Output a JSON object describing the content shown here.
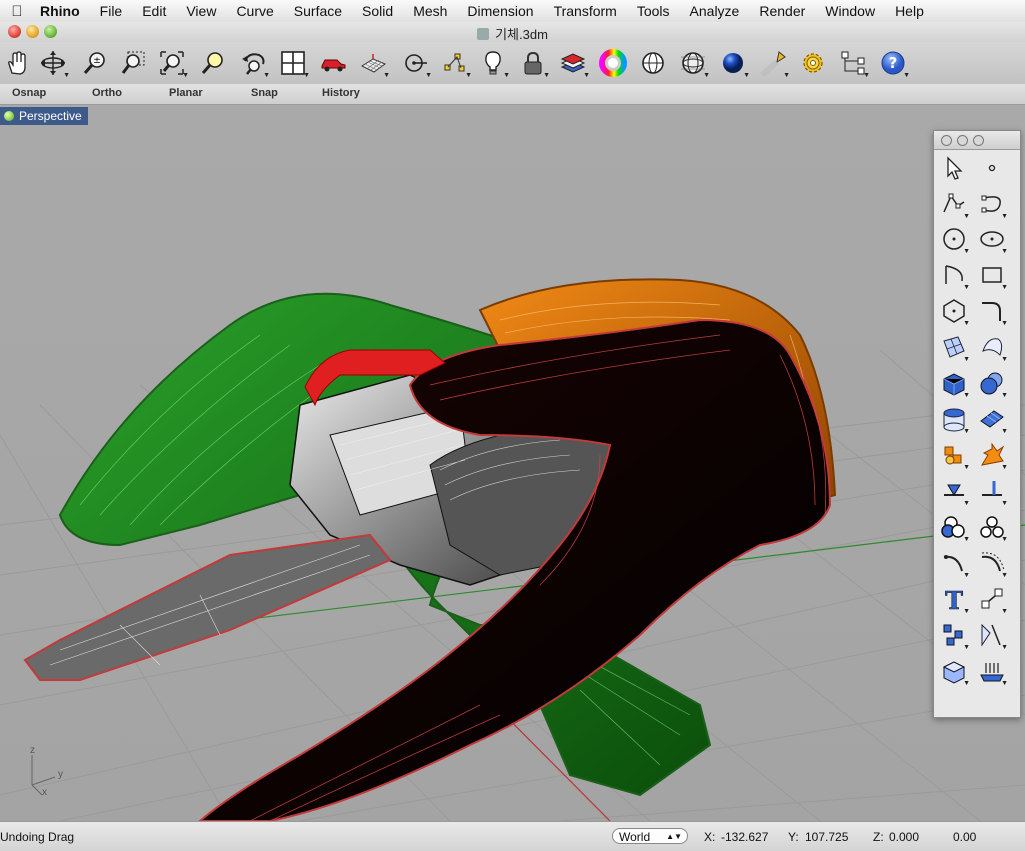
{
  "menubar": {
    "app_name": "Rhino",
    "items": [
      "File",
      "Edit",
      "View",
      "Curve",
      "Surface",
      "Solid",
      "Mesh",
      "Dimension",
      "Transform",
      "Tools",
      "Analyze",
      "Render",
      "Window",
      "Help"
    ]
  },
  "window": {
    "title": "기체.3dm"
  },
  "toolbar": {
    "icons": [
      "pan-icon",
      "rotate-view-icon",
      "zoom-dynamic-icon",
      "zoom-window-icon",
      "zoom-extents-icon",
      "zoom-selected-icon",
      "undo-view-icon",
      "four-viewports-icon",
      "car-properties-icon",
      "grid-plane-icon",
      "osnap-icon",
      "points-icon",
      "light-icon",
      "lock-icon",
      "layer-icon",
      "color-wheel-icon",
      "sphere-wire-icon",
      "sphere-grid-icon",
      "sphere-render-icon",
      "spotlight-icon",
      "gear-icon",
      "hierarchy-icon",
      "help-icon"
    ]
  },
  "togglebar": {
    "items": [
      "Osnap",
      "Ortho",
      "Planar",
      "Snap",
      "History"
    ]
  },
  "viewport": {
    "label": "Perspective",
    "axes": {
      "z": "z",
      "y": "y",
      "x": "x"
    }
  },
  "palette": {
    "icons": [
      "select-arrow-icon",
      "point-icon",
      "polyline-icon",
      "curve-edit-icon",
      "circle-icon",
      "ellipse-icon",
      "arc-icon",
      "rectangle-icon",
      "polygon-icon",
      "fillet-curve-icon",
      "surface-from-points-icon",
      "loft-surface-icon",
      "box-solid-icon",
      "sphere-solid-icon",
      "cylinder-icon",
      "plane-surface-icon",
      "boolean-icon",
      "explode-icon",
      "split-icon",
      "trim-icon",
      "boolean-union-icon",
      "boolean-diff-icon",
      "curve-drag-icon",
      "curve-offset-icon",
      "text-icon",
      "scale-icon",
      "array-icon",
      "mirror-icon",
      "box-render-icon",
      "grid-snap-icon"
    ]
  },
  "statusbar": {
    "message": "Undoing Drag",
    "cplane": "World",
    "x_label": "X:",
    "x_value": "-132.627",
    "y_label": "Y:",
    "y_value": "107.725",
    "z_label": "Z:",
    "z_value": "0.000",
    "extra": "0.00"
  }
}
